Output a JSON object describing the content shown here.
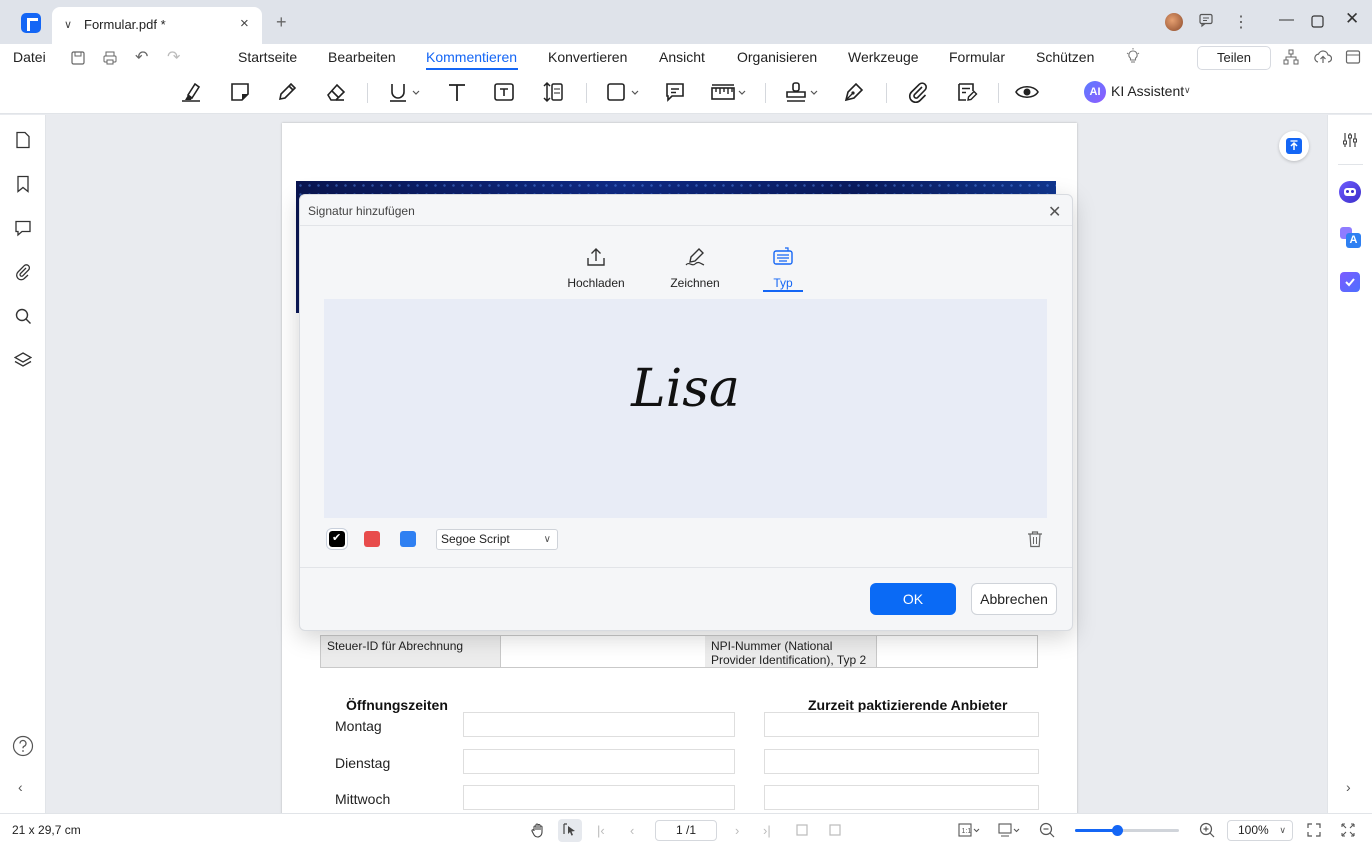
{
  "titlebar": {
    "tab_title": "Formular.pdf *",
    "tab_close": "×",
    "new_tab": "+"
  },
  "menubar": {
    "file_label": "Datei",
    "tabs": [
      "Startseite",
      "Bearbeiten",
      "Kommentieren",
      "Konvertieren",
      "Ansicht",
      "Organisieren",
      "Werkzeuge",
      "Formular",
      "Schützen"
    ],
    "active_tab": "Kommentieren",
    "share_label": "Teilen"
  },
  "toolbar": {
    "ai_badge": "AI",
    "ai_label": "KI Assistent"
  },
  "document": {
    "table_cells": [
      "Steuer-ID für Abrechnung",
      "NPI-Nummer (National Provider Identification), Typ 2"
    ],
    "heading_left": "Öffnungszeiten",
    "heading_right": "Zurzeit paktizierende Anbieter",
    "days": [
      "Montag",
      "Dienstag",
      "Mittwoch"
    ]
  },
  "dialog": {
    "title": "Signatur hinzufügen",
    "tabs": [
      "Hochladen",
      "Zeichnen",
      "Typ"
    ],
    "active_tab": "Typ",
    "signature_text": "Lisa",
    "colors": [
      "#000000",
      "#e84c4c",
      "#2f80f2"
    ],
    "selected_color": "#000000",
    "font_value": "Segoe Script",
    "ok_label": "OK",
    "cancel_label": "Abbrechen"
  },
  "statusbar": {
    "page_size": "21 x 29,7 cm",
    "page_indicator": "1 /1",
    "zoom_value": "100%",
    "zoom_level": 0.4
  },
  "colors": {
    "accent": "#1466f5",
    "dialog_bg": "#f5f6f8",
    "canvas_bg": "#e8ecf6"
  }
}
